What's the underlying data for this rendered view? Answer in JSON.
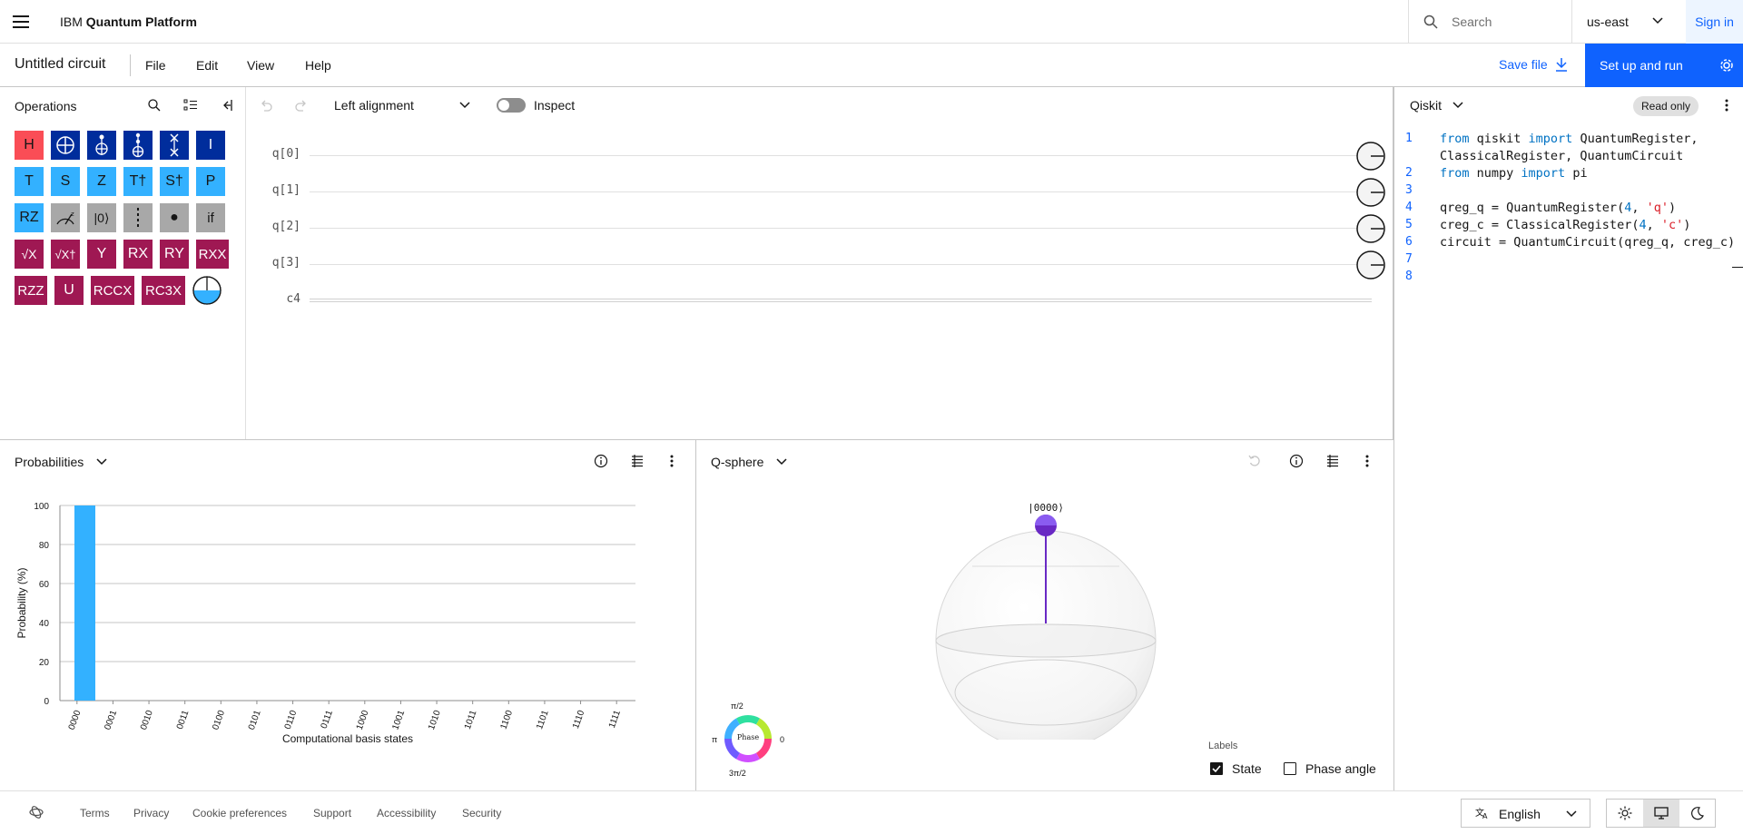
{
  "header": {
    "brand_prefix": "IBM",
    "brand_name": "Quantum Platform",
    "search_placeholder": "Search",
    "region": "us-east",
    "sign_in": "Sign in"
  },
  "toolbar": {
    "circuit_title": "Untitled circuit",
    "menus": [
      "File",
      "Edit",
      "View",
      "Help"
    ],
    "save_file": "Save file",
    "setup_run": "Set up and run"
  },
  "operations": {
    "title": "Operations",
    "gates": [
      "H",
      "CNOT",
      "Toffoli",
      "CCX3",
      "SWAP",
      "I",
      "T",
      "S",
      "Z",
      "T†",
      "S†",
      "P",
      "RZ",
      "Measure",
      "|0⟩",
      "Barrier",
      "●",
      "if",
      "√X",
      "√X†",
      "Y",
      "RX",
      "RY",
      "RXX",
      "RZZ",
      "U",
      "RCCX",
      "RC3X",
      "Phase disk"
    ]
  },
  "composer": {
    "alignment": "Left alignment",
    "inspect_label": "Inspect",
    "qubits": [
      "q[0]",
      "q[1]",
      "q[2]",
      "q[3]"
    ],
    "classical": "c4"
  },
  "code_panel": {
    "language": "Qiskit",
    "read_only": "Read only",
    "line_numbers": [
      "1",
      "2",
      "3",
      "4",
      "5",
      "6",
      "7",
      "8"
    ]
  },
  "probabilities": {
    "title": "Probabilities"
  },
  "qsphere": {
    "title": "Q-sphere",
    "state_label": "|0000⟩",
    "phase_label": "Phase",
    "phase_ticks": {
      "top": "π/2",
      "left": "π",
      "right": "0",
      "bottom": "3π/2"
    },
    "labels_title": "Labels",
    "state_checkbox": "State",
    "state_checked": true,
    "phase_checkbox": "Phase angle",
    "phase_checked": false
  },
  "footer": {
    "links": [
      "Terms",
      "Privacy",
      "Cookie preferences",
      "Support",
      "Accessibility",
      "Security"
    ],
    "language": "English"
  },
  "chart_data": {
    "type": "bar",
    "categories": [
      "0000",
      "0001",
      "0010",
      "0011",
      "0100",
      "0101",
      "0110",
      "0111",
      "1000",
      "1001",
      "1010",
      "1011",
      "1100",
      "1101",
      "1110",
      "1111"
    ],
    "values": [
      100,
      0,
      0,
      0,
      0,
      0,
      0,
      0,
      0,
      0,
      0,
      0,
      0,
      0,
      0,
      0
    ],
    "xlabel": "Computational basis states",
    "ylabel": "Probability (%)",
    "ylim": [
      0,
      100
    ],
    "yticks": [
      0,
      20,
      40,
      60,
      80,
      100
    ],
    "bar_color": "#33b1ff",
    "grid": true
  }
}
